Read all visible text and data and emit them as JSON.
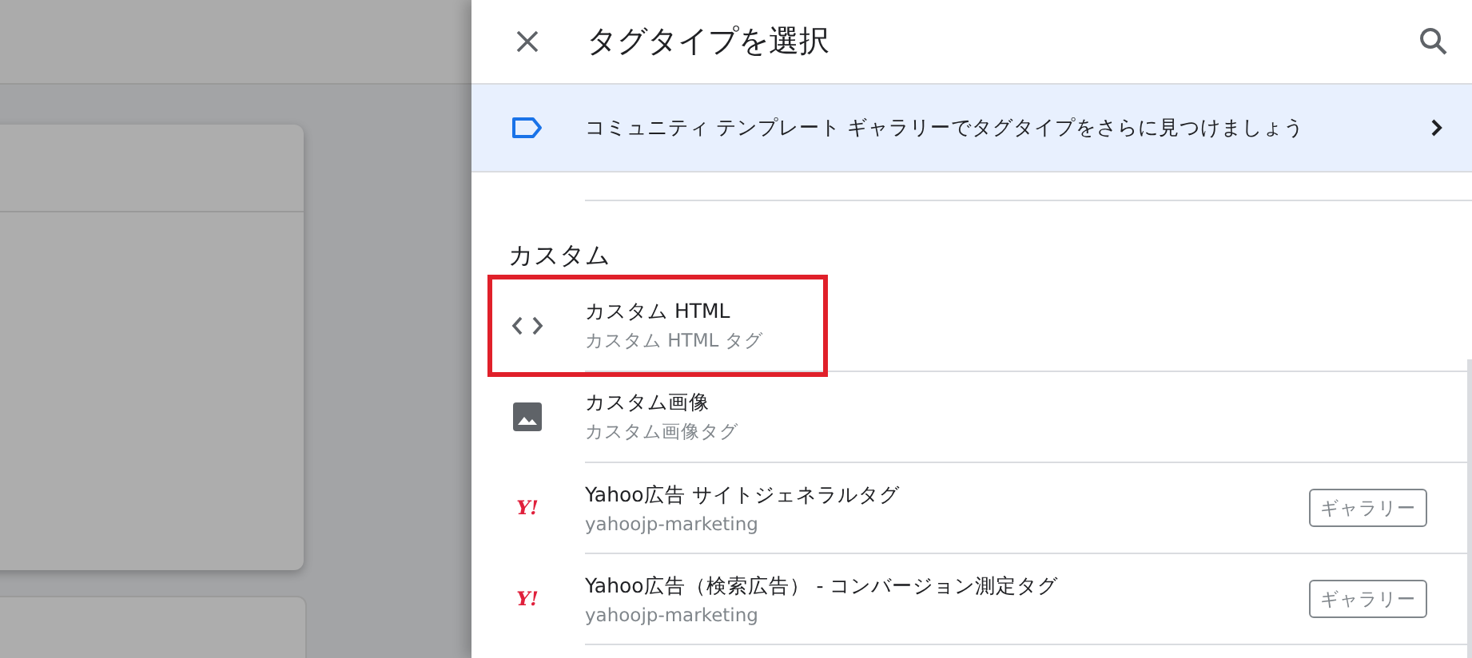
{
  "panel": {
    "title": "タグタイプを選択"
  },
  "banner": {
    "text": "コミュニティ テンプレート ギャラリーでタグタイプをさらに見つけましょう"
  },
  "section": {
    "heading": "カスタム"
  },
  "items": [
    {
      "kind": "code",
      "title": "カスタム HTML",
      "subtitle": "カスタム HTML タグ",
      "highlighted": true
    },
    {
      "kind": "image",
      "title": "カスタム画像",
      "subtitle": "カスタム画像タグ",
      "highlighted": false
    },
    {
      "kind": "yahoo",
      "logo": "Y!",
      "title": "Yahoo広告 サイトジェネラルタグ",
      "subtitle": "yahoojp-marketing",
      "button": "ギャラリー",
      "highlighted": false
    },
    {
      "kind": "yahoo",
      "logo": "Y!",
      "title": "Yahoo広告（検索広告） - コンバージョン測定タグ",
      "subtitle": "yahoojp-marketing",
      "button": "ギャラリー",
      "highlighted": false
    }
  ]
}
